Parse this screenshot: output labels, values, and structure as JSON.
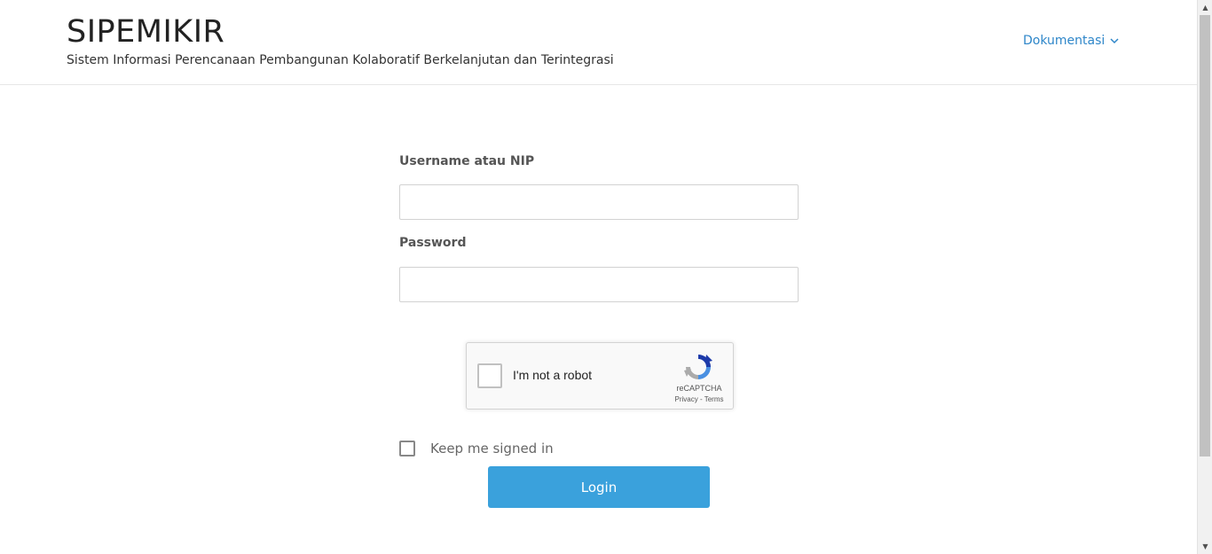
{
  "header": {
    "title": "SIPEMIKIR",
    "subtitle": "Sistem Informasi Perencanaan Pembangunan Kolaboratif Berkelanjutan dan Terintegrasi",
    "nav": {
      "documentation_label": "Dokumentasi",
      "chevron_icon": "chevron-down-icon"
    }
  },
  "form": {
    "username_label": "Username atau NIP",
    "username_value": "",
    "password_label": "Password",
    "password_value": "",
    "keep_signed_in_label": "Keep me signed in",
    "keep_signed_in_checked": false,
    "login_label": "Login"
  },
  "captcha": {
    "checkbox_label": "I'm not a robot",
    "brand": "reCAPTCHA",
    "links": "Privacy - Terms",
    "checked": false
  },
  "colors": {
    "accent": "#3aa1dc",
    "link": "#2e86c9"
  }
}
